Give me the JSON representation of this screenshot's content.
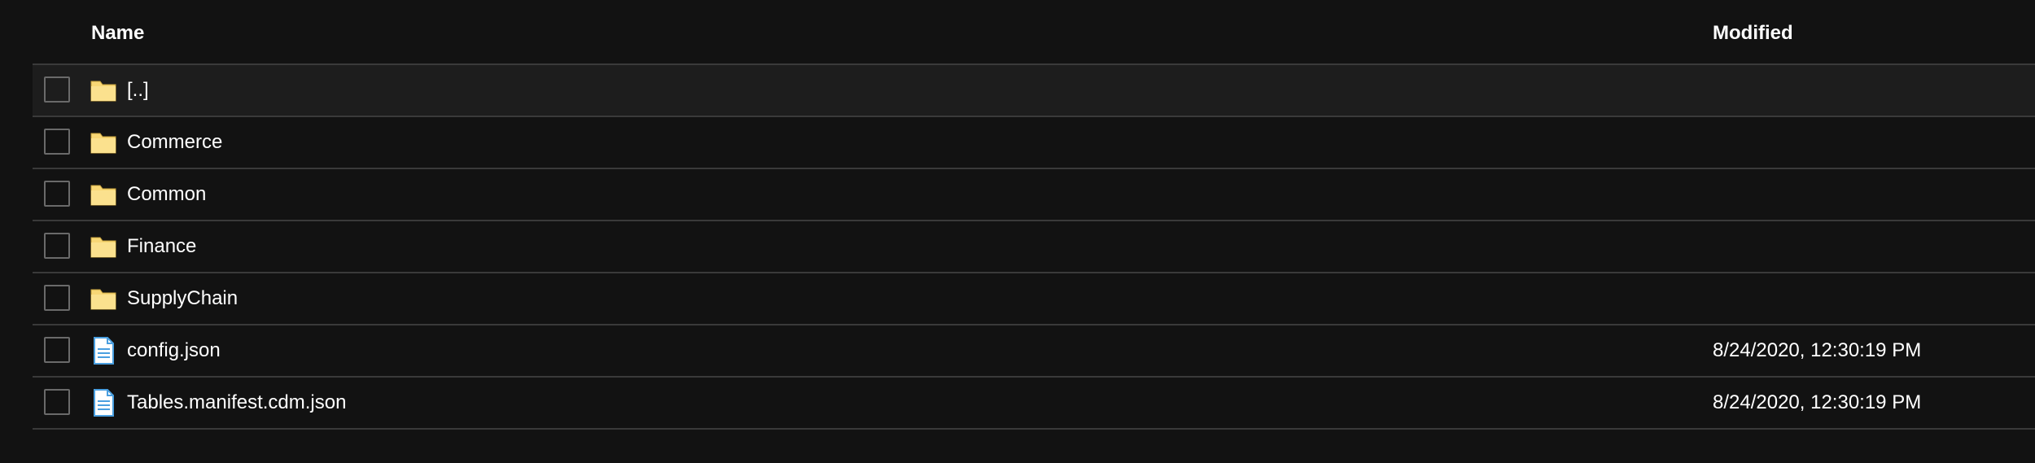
{
  "header": {
    "name_label": "Name",
    "modified_label": "Modified"
  },
  "rows": [
    {
      "name": "[..]",
      "type": "folder-icon",
      "modified": ""
    },
    {
      "name": "Commerce",
      "type": "folder-icon",
      "modified": ""
    },
    {
      "name": "Common",
      "type": "folder-icon",
      "modified": ""
    },
    {
      "name": "Finance",
      "type": "folder-icon",
      "modified": ""
    },
    {
      "name": "SupplyChain",
      "type": "folder-icon",
      "modified": ""
    },
    {
      "name": "config.json",
      "type": "file-icon",
      "modified": "8/24/2020, 12:30:19 PM"
    },
    {
      "name": "Tables.manifest.cdm.json",
      "type": "file-icon",
      "modified": "8/24/2020, 12:30:19 PM"
    }
  ],
  "colors": {
    "background": "#121212",
    "selected_row": "#1d1d1d",
    "divider": "#3a3a3a",
    "folder": "#f8d775",
    "file": "#4a9fe0"
  }
}
